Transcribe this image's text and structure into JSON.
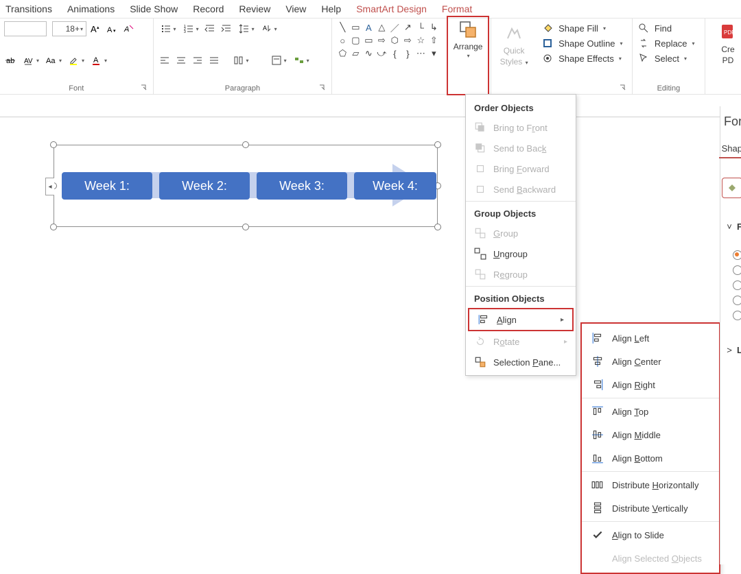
{
  "tabs": {
    "transitions": "Transitions",
    "animations": "Animations",
    "slideshow": "Slide Show",
    "record": "Record",
    "review": "Review",
    "view": "View",
    "help": "Help",
    "smartart": "SmartArt Design",
    "format": "Format"
  },
  "ribbon": {
    "font": {
      "label": "Font",
      "size": "18+"
    },
    "paragraph": {
      "label": "Paragraph"
    },
    "arrange": {
      "label": "Arrange"
    },
    "quickstyles": {
      "line1": "Quick",
      "line2": "Styles"
    },
    "shapefill": "Shape Fill",
    "shapeoutline": "Shape Outline",
    "shapeeffects": "Shape Effects",
    "find": "Find",
    "replace": "Replace",
    "select": "Select",
    "editing": "Editing",
    "createpdf": {
      "line1": "Cre",
      "line2": "PD"
    }
  },
  "smartart": {
    "weeks": [
      "Week 1:",
      "Week 2:",
      "Week 3:",
      "Week 4:"
    ]
  },
  "menu": {
    "order": "Order Objects",
    "bringfront": "Bring to Front",
    "sendback": "Send to Back",
    "bringforward": "Bring Forward",
    "sendbackward": "Send Backward",
    "group_section": "Group Objects",
    "group": "Group",
    "ungroup": "Ungroup",
    "regroup": "Regroup",
    "position": "Position Objects",
    "align": "Align",
    "rotate": "Rotate",
    "selectionpane": "Selection Pane..."
  },
  "alignmenu": {
    "left": "Align Left",
    "center": "Align Center",
    "right": "Align Right",
    "top": "Align Top",
    "middle": "Align Middle",
    "bottom": "Align Bottom",
    "disth": "Distribute Horizontally",
    "distv": "Distribute Vertically",
    "toslide": "Align to Slide",
    "selobj": "Align Selected Objects"
  },
  "pane": {
    "title": "For",
    "tab": "Shap",
    "fsection": "F",
    "lsection": "L"
  }
}
